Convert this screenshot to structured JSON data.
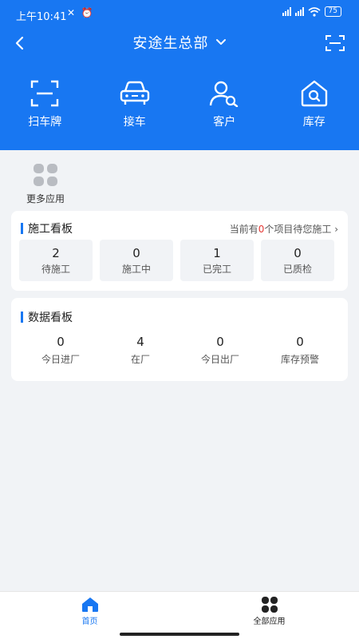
{
  "status_bar": {
    "time": "上午10:41",
    "battery": "75",
    "left_icons": [
      "mute-icon",
      "alarm-icon"
    ],
    "right_icons": [
      "hd-signal-icon",
      "hd-signal-icon",
      "wifi-icon",
      "battery-icon"
    ]
  },
  "header": {
    "title": "安途生总部",
    "back_icon": "back-arrow-icon",
    "dropdown_icon": "chevron-down-icon",
    "scan_icon": "scan-icon",
    "background_color": "#1877f2"
  },
  "quick_actions": [
    {
      "label": "扫车牌",
      "icon": "scan-plate-icon"
    },
    {
      "label": "接车",
      "icon": "car-icon"
    },
    {
      "label": "客户",
      "icon": "customer-search-icon"
    },
    {
      "label": "库存",
      "icon": "inventory-house-icon"
    }
  ],
  "more_apps": {
    "label": "更多应用",
    "icon": "grid-apps-icon"
  },
  "construction_board": {
    "title": "施工看板",
    "hint_prefix": "当前有",
    "hint_count": "0",
    "hint_suffix": "个项目待您施工",
    "hint_arrow": "›",
    "stats": [
      {
        "value": "2",
        "label": "待施工"
      },
      {
        "value": "0",
        "label": "施工中"
      },
      {
        "value": "1",
        "label": "已完工"
      },
      {
        "value": "0",
        "label": "已质检"
      }
    ]
  },
  "data_board": {
    "title": "数据看板",
    "stats": [
      {
        "value": "0",
        "label": "今日进厂"
      },
      {
        "value": "4",
        "label": "在厂"
      },
      {
        "value": "0",
        "label": "今日出厂"
      },
      {
        "value": "0",
        "label": "库存预警"
      }
    ]
  },
  "tab_bar": [
    {
      "label": "首页",
      "icon": "home-icon",
      "active": true,
      "color": "#1877f2"
    },
    {
      "label": "全部应用",
      "icon": "all-apps-icon",
      "active": false
    }
  ]
}
